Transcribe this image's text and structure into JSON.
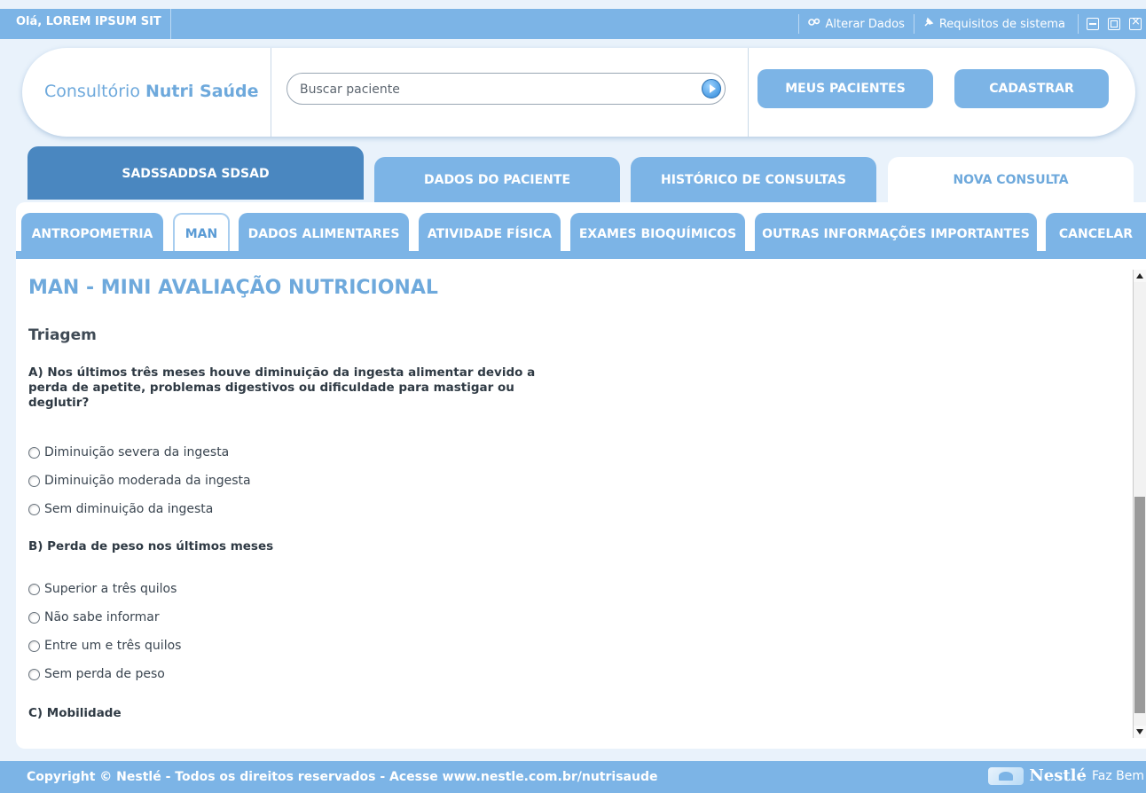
{
  "topbar": {
    "greeting": "Olá, LOREM IPSUM SIT",
    "links": [
      {
        "label": "Alterar Dados",
        "icon": "gear-icon"
      },
      {
        "label": "Requisitos de sistema",
        "icon": "pin-icon"
      }
    ],
    "window_controls": [
      "minimize-icon",
      "maximize-icon",
      "close-icon"
    ]
  },
  "header": {
    "brand_prefix": "Consultório",
    "brand_name": "Nutri Saúde",
    "search_placeholder": "Buscar paciente",
    "buttons": [
      "MEUS PACIENTES",
      "CADASTRAR"
    ]
  },
  "patient_tabs": [
    {
      "label": "SADSSADDSA SDSAD",
      "state": "active-patient"
    },
    {
      "label": "DADOS DO PACIENTE",
      "state": "normal"
    },
    {
      "label": "HISTÓRICO DE CONSULTAS",
      "state": "normal"
    },
    {
      "label": "NOVA CONSULTA",
      "state": "selected"
    }
  ],
  "sub_tabs": [
    {
      "label": "ANTROPOMETRIA"
    },
    {
      "label": "MAN",
      "active": true
    },
    {
      "label": "DADOS ALIMENTARES"
    },
    {
      "label": "ATIVIDADE FÍSICA"
    },
    {
      "label": "EXAMES BIOQUÍMICOS"
    },
    {
      "label": "OUTRAS INFORMAÇÕES IMPORTANTES"
    },
    {
      "label": "CANCELAR"
    }
  ],
  "content": {
    "title": "MAN - MINI AVALIAÇÃO NUTRICIONAL",
    "section": "Triagem",
    "questions": [
      {
        "text": "A) Nos últimos três meses houve diminuição da ingesta alimentar devido a perda de apetite, problemas digestivos ou dificuldade para mastigar ou deglutir?",
        "lines": [
          "A) Nos últimos três meses houve diminuição da ingesta alimentar devido a",
          "perda de apetite, problemas digestivos ou dificuldade para mastigar ou",
          "deglutir?"
        ],
        "options": [
          "Diminuição severa da ingesta",
          "Diminuição moderada da ingesta",
          "Sem diminuição da ingesta"
        ]
      },
      {
        "text": "B) Perda de peso nos últimos meses",
        "options": [
          "Superior a três quilos",
          "Não sabe informar",
          "Entre um e três quilos",
          "Sem perda de peso"
        ]
      },
      {
        "text": "C) Mobilidade",
        "options": []
      }
    ]
  },
  "footer": {
    "copyright": "Copyright © Nestlé - Todos os direitos reservados -",
    "link": "Acesse www.nestle.com.br/nutrisaude",
    "brand": "Nestlé",
    "tagline": "Faz Bem"
  },
  "colors": {
    "accent": "#7cb4e6",
    "dark_tab": "#4a87c0",
    "title": "#6ea9dc",
    "background": "#e9f2fb"
  }
}
